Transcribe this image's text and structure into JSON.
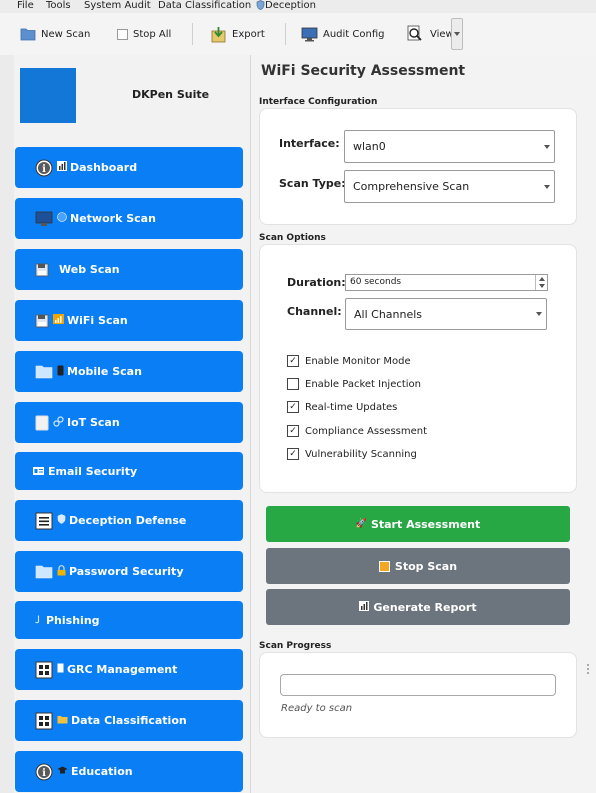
{
  "menu": {
    "file": "File",
    "tools": "Tools",
    "system_audit": "System Audit",
    "data_classification": "Data Classification",
    "deception": "Deception"
  },
  "toolbar": {
    "new_scan": "New Scan",
    "stop_all": "Stop All",
    "export": "Export",
    "audit_config": "Audit Config",
    "view": "View"
  },
  "sidebar": {
    "app_name": "DKPen Suite",
    "items": [
      {
        "label": "Dashboard",
        "icon": "info-circle-icon"
      },
      {
        "label": "Network Scan",
        "icon": "monitor-icon"
      },
      {
        "label": "Web Scan",
        "icon": "floppy-icon"
      },
      {
        "label": "WiFi Scan",
        "icon": "wifi-bars-icon"
      },
      {
        "label": "Mobile Scan",
        "icon": "phone-icon"
      },
      {
        "label": "IoT Scan",
        "icon": "link-icon"
      },
      {
        "label": "Email Security",
        "icon": "id-card-icon"
      },
      {
        "label": "Deception Defense",
        "icon": "shield-icon"
      },
      {
        "label": "Password Security",
        "icon": "lock-icon"
      },
      {
        "label": "Phishing",
        "icon": "hook-icon"
      },
      {
        "label": "GRC Management",
        "icon": "grid-icon"
      },
      {
        "label": "Data Classification",
        "icon": "folder-icon"
      },
      {
        "label": "Education",
        "icon": "graduation-cap-icon"
      }
    ]
  },
  "main": {
    "title": "WiFi Security Assessment",
    "interface_section": "Interface Configuration",
    "interface_label": "Interface:",
    "interface_value": "wlan0",
    "scan_type_label": "Scan Type:",
    "scan_type_value": "Comprehensive Scan",
    "options_section": "Scan Options",
    "duration_label": "Duration:",
    "duration_value": "60 seconds",
    "channel_label": "Channel:",
    "channel_value": "All Channels",
    "checks": [
      {
        "label": "Enable Monitor Mode",
        "checked": true
      },
      {
        "label": "Enable Packet Injection",
        "checked": false
      },
      {
        "label": "Real-time Updates",
        "checked": true
      },
      {
        "label": "Compliance Assessment",
        "checked": true
      },
      {
        "label": "Vulnerability Scanning",
        "checked": true
      }
    ],
    "start_button": "Start Assessment",
    "stop_button": "Stop Scan",
    "report_button": "Generate Report",
    "progress_section": "Scan Progress",
    "progress_value": 0,
    "status_text": "Ready to scan"
  },
  "colors": {
    "nav": "#0a7ff5",
    "start": "#28a745",
    "stop": "#6c757d",
    "logo": "#1377d7"
  }
}
